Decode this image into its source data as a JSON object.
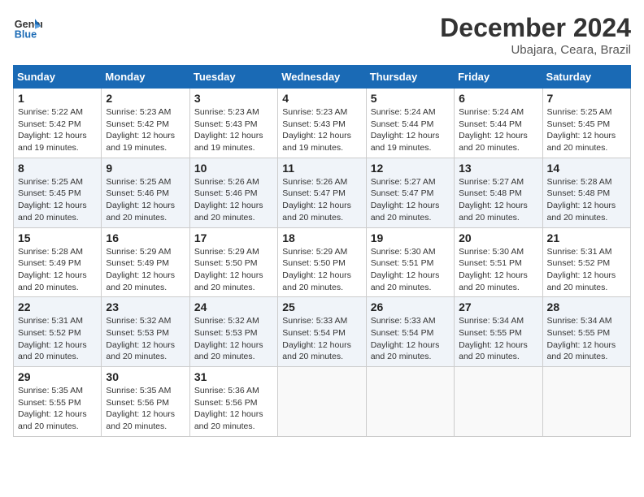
{
  "header": {
    "logo_line1": "General",
    "logo_line2": "Blue",
    "month_title": "December 2024",
    "location": "Ubajara, Ceara, Brazil"
  },
  "days_of_week": [
    "Sunday",
    "Monday",
    "Tuesday",
    "Wednesday",
    "Thursday",
    "Friday",
    "Saturday"
  ],
  "weeks": [
    [
      {
        "day": "1",
        "info": "Sunrise: 5:22 AM\nSunset: 5:42 PM\nDaylight: 12 hours\nand 19 minutes."
      },
      {
        "day": "2",
        "info": "Sunrise: 5:23 AM\nSunset: 5:42 PM\nDaylight: 12 hours\nand 19 minutes."
      },
      {
        "day": "3",
        "info": "Sunrise: 5:23 AM\nSunset: 5:43 PM\nDaylight: 12 hours\nand 19 minutes."
      },
      {
        "day": "4",
        "info": "Sunrise: 5:23 AM\nSunset: 5:43 PM\nDaylight: 12 hours\nand 19 minutes."
      },
      {
        "day": "5",
        "info": "Sunrise: 5:24 AM\nSunset: 5:44 PM\nDaylight: 12 hours\nand 19 minutes."
      },
      {
        "day": "6",
        "info": "Sunrise: 5:24 AM\nSunset: 5:44 PM\nDaylight: 12 hours\nand 20 minutes."
      },
      {
        "day": "7",
        "info": "Sunrise: 5:25 AM\nSunset: 5:45 PM\nDaylight: 12 hours\nand 20 minutes."
      }
    ],
    [
      {
        "day": "8",
        "info": "Sunrise: 5:25 AM\nSunset: 5:45 PM\nDaylight: 12 hours\nand 20 minutes."
      },
      {
        "day": "9",
        "info": "Sunrise: 5:25 AM\nSunset: 5:46 PM\nDaylight: 12 hours\nand 20 minutes."
      },
      {
        "day": "10",
        "info": "Sunrise: 5:26 AM\nSunset: 5:46 PM\nDaylight: 12 hours\nand 20 minutes."
      },
      {
        "day": "11",
        "info": "Sunrise: 5:26 AM\nSunset: 5:47 PM\nDaylight: 12 hours\nand 20 minutes."
      },
      {
        "day": "12",
        "info": "Sunrise: 5:27 AM\nSunset: 5:47 PM\nDaylight: 12 hours\nand 20 minutes."
      },
      {
        "day": "13",
        "info": "Sunrise: 5:27 AM\nSunset: 5:48 PM\nDaylight: 12 hours\nand 20 minutes."
      },
      {
        "day": "14",
        "info": "Sunrise: 5:28 AM\nSunset: 5:48 PM\nDaylight: 12 hours\nand 20 minutes."
      }
    ],
    [
      {
        "day": "15",
        "info": "Sunrise: 5:28 AM\nSunset: 5:49 PM\nDaylight: 12 hours\nand 20 minutes."
      },
      {
        "day": "16",
        "info": "Sunrise: 5:29 AM\nSunset: 5:49 PM\nDaylight: 12 hours\nand 20 minutes."
      },
      {
        "day": "17",
        "info": "Sunrise: 5:29 AM\nSunset: 5:50 PM\nDaylight: 12 hours\nand 20 minutes."
      },
      {
        "day": "18",
        "info": "Sunrise: 5:29 AM\nSunset: 5:50 PM\nDaylight: 12 hours\nand 20 minutes."
      },
      {
        "day": "19",
        "info": "Sunrise: 5:30 AM\nSunset: 5:51 PM\nDaylight: 12 hours\nand 20 minutes."
      },
      {
        "day": "20",
        "info": "Sunrise: 5:30 AM\nSunset: 5:51 PM\nDaylight: 12 hours\nand 20 minutes."
      },
      {
        "day": "21",
        "info": "Sunrise: 5:31 AM\nSunset: 5:52 PM\nDaylight: 12 hours\nand 20 minutes."
      }
    ],
    [
      {
        "day": "22",
        "info": "Sunrise: 5:31 AM\nSunset: 5:52 PM\nDaylight: 12 hours\nand 20 minutes."
      },
      {
        "day": "23",
        "info": "Sunrise: 5:32 AM\nSunset: 5:53 PM\nDaylight: 12 hours\nand 20 minutes."
      },
      {
        "day": "24",
        "info": "Sunrise: 5:32 AM\nSunset: 5:53 PM\nDaylight: 12 hours\nand 20 minutes."
      },
      {
        "day": "25",
        "info": "Sunrise: 5:33 AM\nSunset: 5:54 PM\nDaylight: 12 hours\nand 20 minutes."
      },
      {
        "day": "26",
        "info": "Sunrise: 5:33 AM\nSunset: 5:54 PM\nDaylight: 12 hours\nand 20 minutes."
      },
      {
        "day": "27",
        "info": "Sunrise: 5:34 AM\nSunset: 5:55 PM\nDaylight: 12 hours\nand 20 minutes."
      },
      {
        "day": "28",
        "info": "Sunrise: 5:34 AM\nSunset: 5:55 PM\nDaylight: 12 hours\nand 20 minutes."
      }
    ],
    [
      {
        "day": "29",
        "info": "Sunrise: 5:35 AM\nSunset: 5:55 PM\nDaylight: 12 hours\nand 20 minutes."
      },
      {
        "day": "30",
        "info": "Sunrise: 5:35 AM\nSunset: 5:56 PM\nDaylight: 12 hours\nand 20 minutes."
      },
      {
        "day": "31",
        "info": "Sunrise: 5:36 AM\nSunset: 5:56 PM\nDaylight: 12 hours\nand 20 minutes."
      },
      {
        "day": "",
        "info": ""
      },
      {
        "day": "",
        "info": ""
      },
      {
        "day": "",
        "info": ""
      },
      {
        "day": "",
        "info": ""
      }
    ]
  ]
}
